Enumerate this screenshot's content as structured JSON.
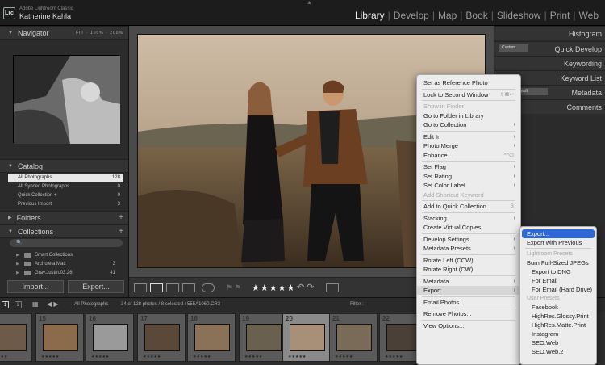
{
  "topbar": {
    "logo": "Lrc",
    "app_name": "Adobe Lightroom Classic",
    "user_name": "Katherine Kahla",
    "modules": [
      "Library",
      "Develop",
      "Map",
      "Book",
      "Slideshow",
      "Print",
      "Web"
    ],
    "active_module": "Library"
  },
  "left_panel": {
    "navigator": {
      "title": "Navigator",
      "opts": [
        "FIT",
        "100%",
        "200%"
      ]
    },
    "catalog": {
      "title": "Catalog",
      "items": [
        {
          "label": "All Photographs",
          "count": "128"
        },
        {
          "label": "All Synced Photographs",
          "count": "0"
        },
        {
          "label": "Quick Collection +",
          "count": "0"
        },
        {
          "label": "Previous Import",
          "count": "3"
        }
      ]
    },
    "folders": {
      "title": "Folders"
    },
    "collections": {
      "title": "Collections",
      "items": [
        {
          "label": "Smart Collections",
          "count": ""
        },
        {
          "label": "Archuleta.Matt",
          "count": "3"
        },
        {
          "label": "Gray.Justin.03.26",
          "count": "41"
        }
      ]
    },
    "import_label": "Import...",
    "export_label": "Export..."
  },
  "right_panel": {
    "sections": [
      "Histogram",
      "Quick Develop",
      "Keywording",
      "Keyword List",
      "Metadata",
      "Comments"
    ],
    "qd_preset": "Custom",
    "metadata_preset": "ault"
  },
  "toolbar": {
    "stars": "★★★★★"
  },
  "filmstrip_bar": {
    "page1": "1",
    "page2": "2",
    "source": "All Photographs",
    "info": "34 of 128 photos / 8 selected / 555A1060.CR3",
    "filter_label": "Filter :"
  },
  "filmstrip": {
    "numbers": [
      "",
      "15",
      "16",
      "17",
      "18",
      "19",
      "20",
      "21",
      "22"
    ]
  },
  "context_menu": {
    "items": [
      {
        "label": "Set as Reference Photo",
        "sub": false,
        "dis": false
      },
      {
        "sep": true
      },
      {
        "label": "Lock to Second Window",
        "sc": "⇧⌘↩",
        "dis": false
      },
      {
        "sep": true
      },
      {
        "label": "Show in Finder",
        "dis": true
      },
      {
        "label": "Go to Folder in Library",
        "dis": false
      },
      {
        "label": "Go to Collection",
        "sub": true
      },
      {
        "sep": true
      },
      {
        "label": "Edit In",
        "sub": true
      },
      {
        "label": "Photo Merge",
        "sub": true
      },
      {
        "label": "Enhance...",
        "sc": "^⌥I"
      },
      {
        "sep": true
      },
      {
        "label": "Set Flag",
        "sub": true
      },
      {
        "label": "Set Rating",
        "sub": true
      },
      {
        "label": "Set Color Label",
        "sub": true
      },
      {
        "label": "Add Shortcut Keyword",
        "dis": true
      },
      {
        "sep": true
      },
      {
        "label": "Add to Quick Collection",
        "sc": "B"
      },
      {
        "sep": true
      },
      {
        "label": "Stacking",
        "sub": true
      },
      {
        "label": "Create Virtual Copies"
      },
      {
        "sep": true
      },
      {
        "label": "Develop Settings",
        "sub": true
      },
      {
        "label": "Metadata Presets",
        "sub": true
      },
      {
        "sep": true
      },
      {
        "label": "Rotate Left (CCW)"
      },
      {
        "label": "Rotate Right (CW)"
      },
      {
        "sep": true
      },
      {
        "label": "Metadata",
        "sub": true
      },
      {
        "label": "Export",
        "sub": true,
        "hover": true
      },
      {
        "sep": true
      },
      {
        "label": "Email Photos..."
      },
      {
        "sep": true
      },
      {
        "label": "Remove Photos..."
      },
      {
        "sep": true
      },
      {
        "label": "View Options...",
        "dis": false
      }
    ]
  },
  "export_submenu": {
    "items": [
      {
        "label": "Export...",
        "hi": true
      },
      {
        "label": "Export with Previous"
      },
      {
        "sep": true
      },
      {
        "group": "Lightroom Presets"
      },
      {
        "label": "Burn Full-Sized JPEGs"
      },
      {
        "label": "Export to DNG"
      },
      {
        "label": "For Email"
      },
      {
        "label": "For Email (Hard Drive)"
      },
      {
        "group": "User Presets"
      },
      {
        "label": "Facebook"
      },
      {
        "label": "HighRes.Glossy.Print"
      },
      {
        "label": "HighRes.Matte.Print"
      },
      {
        "label": "Instagram"
      },
      {
        "label": "SEO.Web"
      },
      {
        "label": "SEO.Web.2"
      }
    ]
  },
  "colors": {
    "menu_highlight": "#2e67d6",
    "panel_bg": "#2b2b2b",
    "active_text": "#eeeeee"
  }
}
